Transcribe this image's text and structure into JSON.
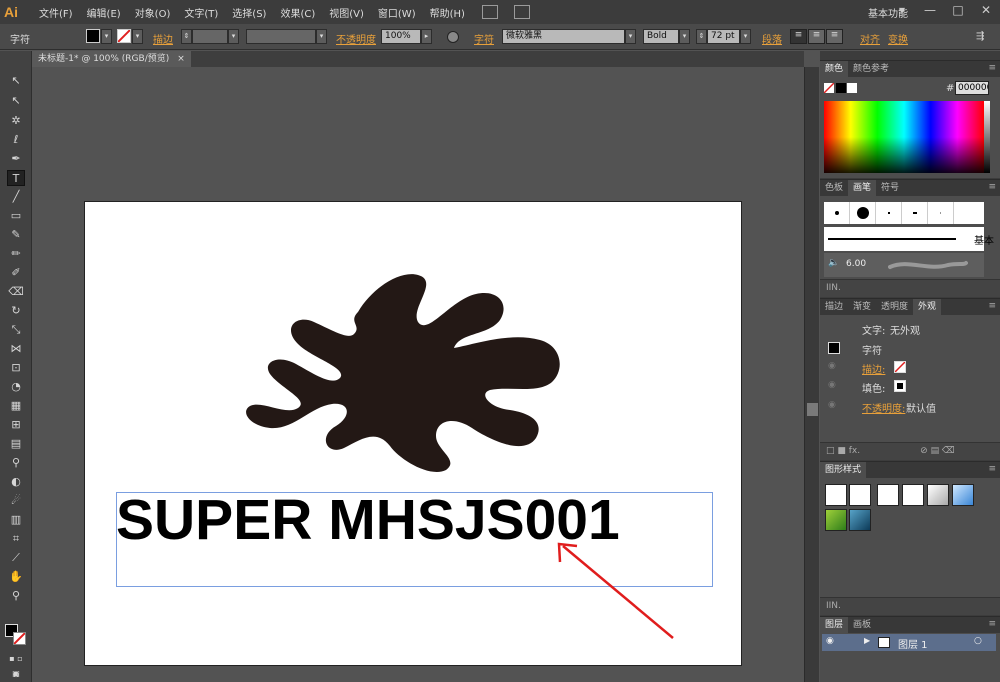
{
  "app": {
    "logo": "Ai",
    "menu": [
      "文件(F)",
      "编辑(E)",
      "对象(O)",
      "文字(T)",
      "选择(S)",
      "效果(C)",
      "视图(V)",
      "窗口(W)",
      "帮助(H)"
    ],
    "workspace": "基本功能",
    "window_buttons": [
      "▾",
      "—",
      "□",
      "✕"
    ]
  },
  "controlbar": {
    "selection_label": "字符",
    "stroke_label": "描边",
    "opacity_label": "不透明度",
    "opacity_value": "100%",
    "char_label": "字符",
    "font_family": "微软雅黑",
    "font_style": "Bold",
    "font_size": "72 pt",
    "paragraph_label": "段落",
    "align_label": "对齐",
    "transform_label": "变换",
    "colors": {
      "fill": "#000000",
      "stroke": "#ffffff"
    }
  },
  "document": {
    "tab_title": "未标题-1* @ 100% (RGB/预览)",
    "tab_close": "×",
    "text_content": "SUPER MHSJS001"
  },
  "panels": {
    "color": {
      "tabs": [
        "颜色",
        "颜色参考"
      ],
      "hex_label": "#",
      "hex_value": "000000"
    },
    "brushes": {
      "tabs": [
        "色板",
        "画笔",
        "符号"
      ],
      "basic_label": "基本",
      "size_value": "6.00"
    },
    "appearance": {
      "tabs": [
        "描边",
        "渐变",
        "透明度",
        "外观"
      ],
      "header_label": "文字:",
      "header_value": "无外观",
      "rows": [
        {
          "label": "字符",
          "value": ""
        },
        {
          "label": "描边:",
          "value": ""
        },
        {
          "label": "填色:",
          "value": ""
        },
        {
          "label": "不透明度:",
          "value": "默认值"
        }
      ]
    },
    "graphic_styles": {
      "tabs": [
        "图形样式"
      ]
    },
    "layers": {
      "tabs": [
        "图层",
        "画板"
      ],
      "layer_name": "图层 1"
    }
  }
}
